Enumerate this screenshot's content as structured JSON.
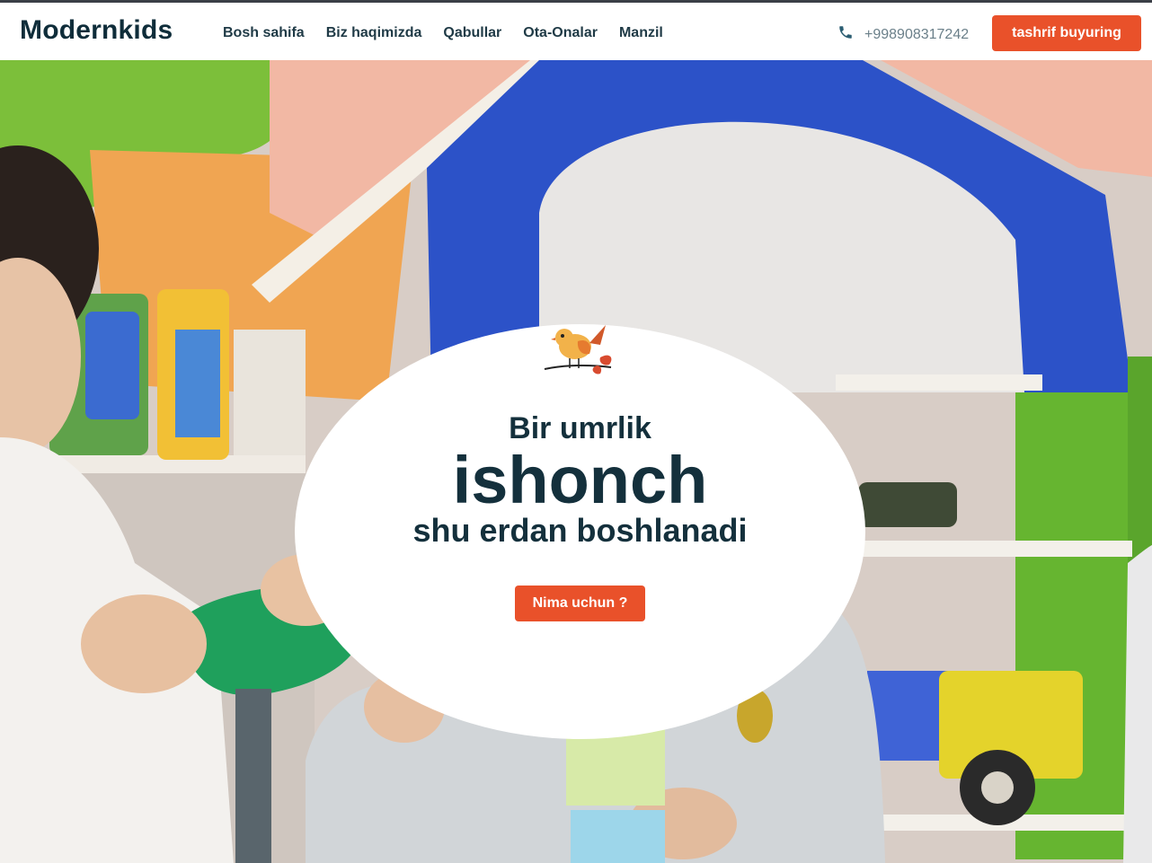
{
  "header": {
    "logo": "Modernkids",
    "nav": [
      "Bosh sahifa",
      "Biz haqimizda",
      "Qabullar",
      "Ota-Onalar",
      "Manzil"
    ],
    "phone_icon": "phone-icon",
    "phone": "+998908317242",
    "cta_label": "tashrif buyuring"
  },
  "hero": {
    "line1": "Bir umrlik",
    "line2": "ishonch",
    "line3": "shu erdan boshlanadi",
    "button_label": "Nima uchun ?",
    "bird_icon": "bird-icon"
  },
  "colors": {
    "accent": "#e9512a",
    "heading": "#14303c",
    "nav_text": "#1f3a46"
  }
}
